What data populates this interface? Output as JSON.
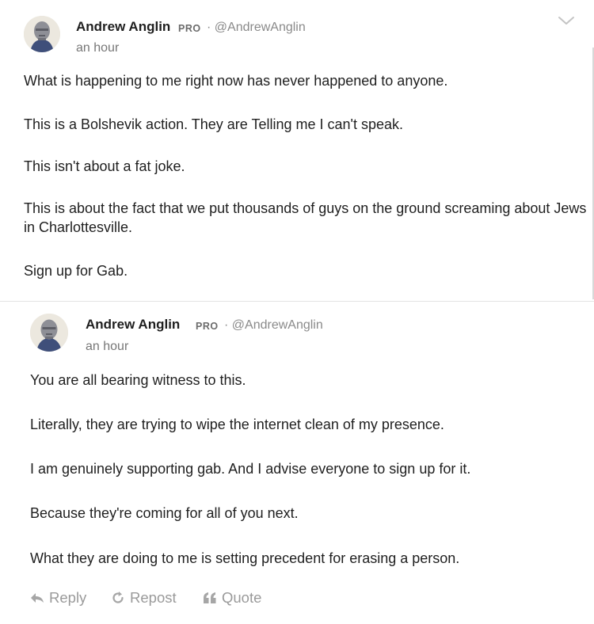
{
  "posts": [
    {
      "author": "Andrew Anglin",
      "badge": "PRO",
      "handle": "· @AndrewAnglin",
      "time": "an hour",
      "paragraphs": [
        "What is happening to me right now has never happened to anyone.",
        "This is a Bolshevik action. They are Telling me I can't speak.",
        "This isn't about a fat joke.",
        "This is about the fact that we put thousands of guys on the ground screaming about Jews in Charlottesville.",
        "Sign up for Gab."
      ]
    },
    {
      "author": "Andrew Anglin",
      "badge": "PRO",
      "handle": "· @AndrewAnglin",
      "time": "an hour",
      "paragraphs": [
        "You are all bearing witness to this.",
        "Literally, they are trying to wipe the internet clean of my presence.",
        "I am genuinely supporting gab. And I advise everyone to sign up for it.",
        "Because they're coming for all of you next.",
        "What they are doing to me is setting precedent for erasing a person."
      ]
    }
  ],
  "actions": {
    "reply": "Reply",
    "repost": "Repost",
    "quote": "Quote"
  },
  "icons": {
    "menu": "chevron-down-icon",
    "reply": "reply-arrow-icon",
    "repost": "repost-icon",
    "quote": "quote-icon",
    "avatar": "avatar"
  },
  "colors": {
    "text": "#1f1f1f",
    "muted": "#8a8a8a",
    "action": "#9a9a9a",
    "divider": "#e3e3e3"
  }
}
